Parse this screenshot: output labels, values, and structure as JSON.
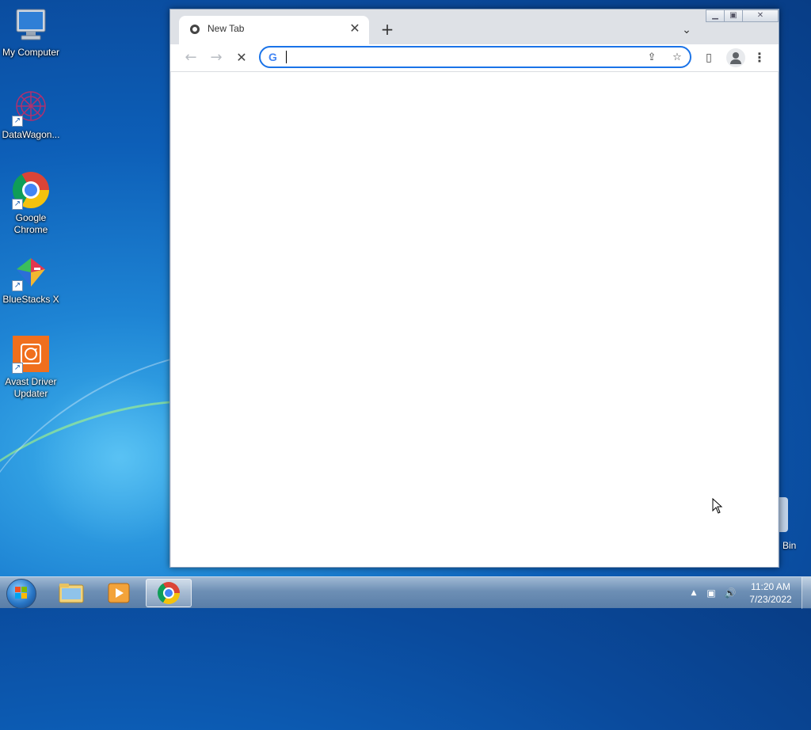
{
  "desktop": {
    "icons": [
      {
        "label": "My Computer",
        "icon": "computer-icon"
      },
      {
        "label": "DataWagon...",
        "icon": "datawagon-icon"
      },
      {
        "label": "Google Chrome",
        "icon": "chrome-icon"
      },
      {
        "label": "BlueStacks X",
        "icon": "bluestacks-icon"
      },
      {
        "label": "Avast Driver Updater",
        "icon": "avast-icon"
      }
    ],
    "recycle_bin_label": "Bin"
  },
  "browser": {
    "tab_title": "New Tab",
    "new_tab_symbol": "+",
    "tab_close_symbol": "✕",
    "tab_search_symbol": "⌄",
    "omnibox": {
      "value": "",
      "placeholder": ""
    },
    "google_badge": "G",
    "nav": {
      "back": "←",
      "forward": "→",
      "stop": "✕"
    },
    "window_buttons": {
      "minimize": "▁",
      "maximize": "▣",
      "close": "✕"
    },
    "toolbar_icons": {
      "share": "⇪",
      "bookmark": "☆",
      "side_panel": "▯",
      "menu": "⋮"
    }
  },
  "taskbar": {
    "clock_time": "11:20 AM",
    "clock_date": "7/23/2022",
    "tray": {
      "arrow": "▲",
      "network": "▣",
      "volume": "🔊"
    }
  },
  "colors": {
    "accent": "#1a73e8",
    "tabstrip": "#dee1e6"
  }
}
